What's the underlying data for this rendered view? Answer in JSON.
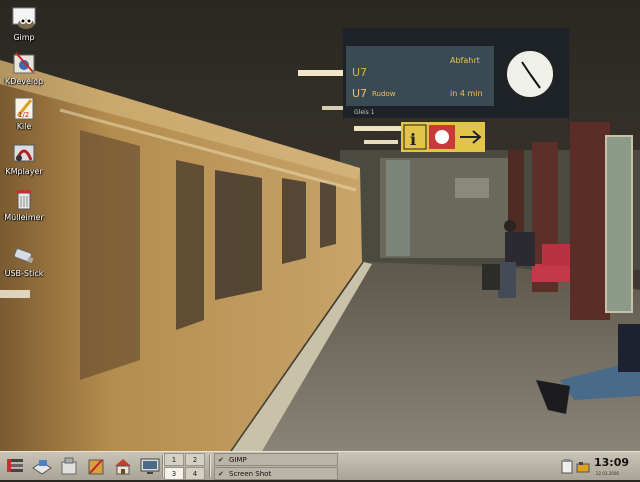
{
  "desktop": {
    "icons": [
      {
        "label": "Gimp",
        "icon": "gimp-icon"
      },
      {
        "label": "KDevelop",
        "icon": "kdevelop-icon"
      },
      {
        "label": "Kile",
        "icon": "kile-icon"
      },
      {
        "label": "KMplayer",
        "icon": "kmplayer-icon"
      },
      {
        "label": "Mülleimer",
        "icon": "trash-icon"
      },
      {
        "label": "USB-Stick",
        "icon": "usb-stick-icon"
      }
    ],
    "wallpaper": {
      "sign_departure": "Abfahrt",
      "sign_platform": "Gleis 1",
      "sign_line_1": "U7",
      "sign_line_2": "U7",
      "sign_destination": "Rudow",
      "sign_time": "in 4 min"
    }
  },
  "taskbar": {
    "launchers": [
      "kmenu-icon",
      "office-icon",
      "package-icon",
      "tools-icon",
      "home-icon",
      "monitor-icon"
    ],
    "pager": [
      "1",
      "2",
      "3",
      "4"
    ],
    "pager_active": "3",
    "tasks": [
      "GIMP",
      "Screen Shot"
    ],
    "tray_icons": [
      "clipboard-icon",
      "network-icon"
    ],
    "clock": {
      "time": "13:09",
      "date": "22.03.2006"
    }
  },
  "colors": {
    "taskbar": "#bdb8aa",
    "wall": "#3a352c",
    "train": "#b08a4a"
  }
}
